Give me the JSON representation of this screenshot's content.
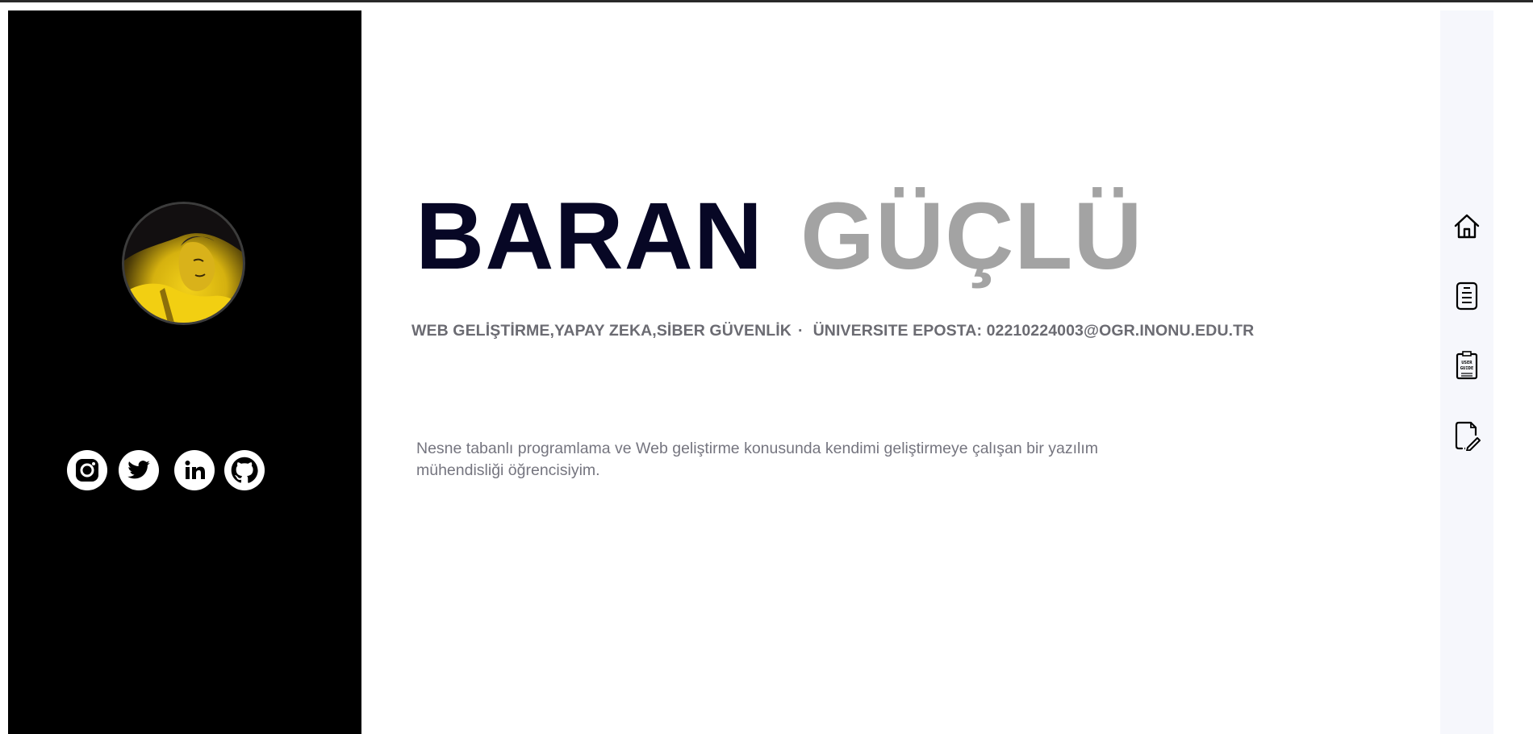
{
  "profile": {
    "first_name": "BARAN",
    "last_name": "GÜÇLÜ",
    "interests": "WEB GELİŞTİRME,YAPAY ZEKA,SİBER GÜVENLİK",
    "separator": "·",
    "email_line": "ÜNIVERSITE EPOSTA: 02210224003@OGR.INONU.EDU.TR",
    "bio": "Nesne tabanlı programlama ve Web geliştirme konusunda kendimi geliştirmeye çalışan bir yazılım mühendisliği öğrencisiyim."
  },
  "socials": [
    {
      "name": "instagram",
      "icon": "instagram-icon"
    },
    {
      "name": "twitter",
      "icon": "twitter-icon"
    },
    {
      "name": "linkedin",
      "icon": "linkedin-icon",
      "text": "in"
    },
    {
      "name": "github",
      "icon": "github-icon"
    }
  ],
  "rightnav": {
    "items": [
      {
        "icon": "home-icon"
      },
      {
        "icon": "document-icon"
      },
      {
        "icon": "user-guide-icon",
        "text_line1": "USER",
        "text_line2": "GUIDE"
      },
      {
        "icon": "edit-document-icon"
      }
    ]
  },
  "colors": {
    "sidebar_bg": "#000000",
    "first_name": "#070725",
    "last_name": "#a3a3a3",
    "text_muted": "#6b6b72",
    "rightnav_bg": "#f6f7fc"
  }
}
